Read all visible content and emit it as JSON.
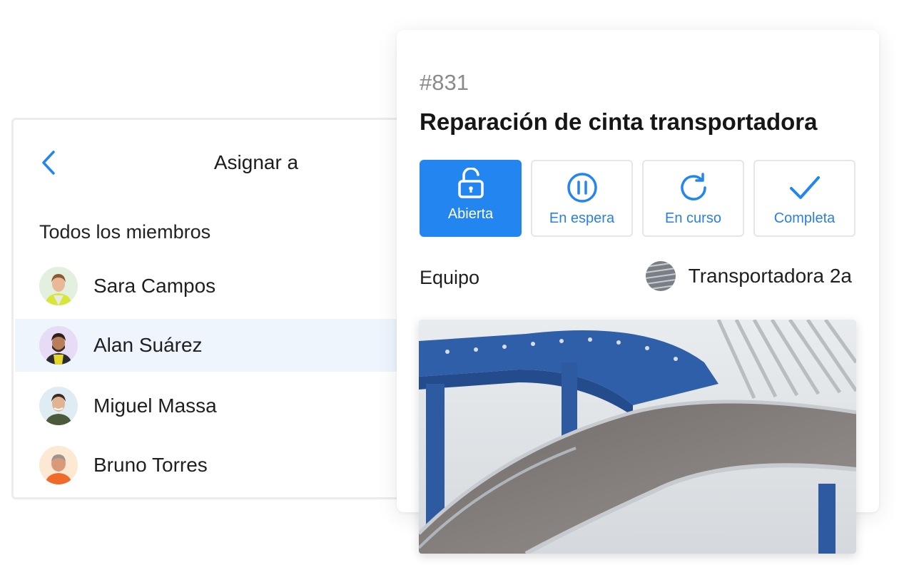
{
  "assign": {
    "title": "Asignar a",
    "section_label": "Todos los miembros",
    "members": [
      {
        "name": "Sara Campos",
        "selected": false
      },
      {
        "name": "Alan Suárez",
        "selected": true
      },
      {
        "name": "Miguel Massa",
        "selected": false
      },
      {
        "name": "Bruno Torres",
        "selected": false
      }
    ]
  },
  "work_order": {
    "number": "#831",
    "title": "Reparación de cinta transportadora",
    "statuses": [
      {
        "label": "Abierta",
        "icon": "unlock-icon",
        "active": true
      },
      {
        "label": "En espera",
        "icon": "pause-icon",
        "active": false
      },
      {
        "label": "En curso",
        "icon": "refresh-icon",
        "active": false
      },
      {
        "label": "Completa",
        "icon": "check-icon",
        "active": false
      }
    ],
    "equipment_label": "Equipo",
    "equipment_value": "Transportadora 2a",
    "image_subject": "conveyor-belt-photo"
  },
  "colors": {
    "accent": "#2285f0",
    "selected_row": "#eef5fd",
    "muted_text": "#8a8a8a"
  }
}
